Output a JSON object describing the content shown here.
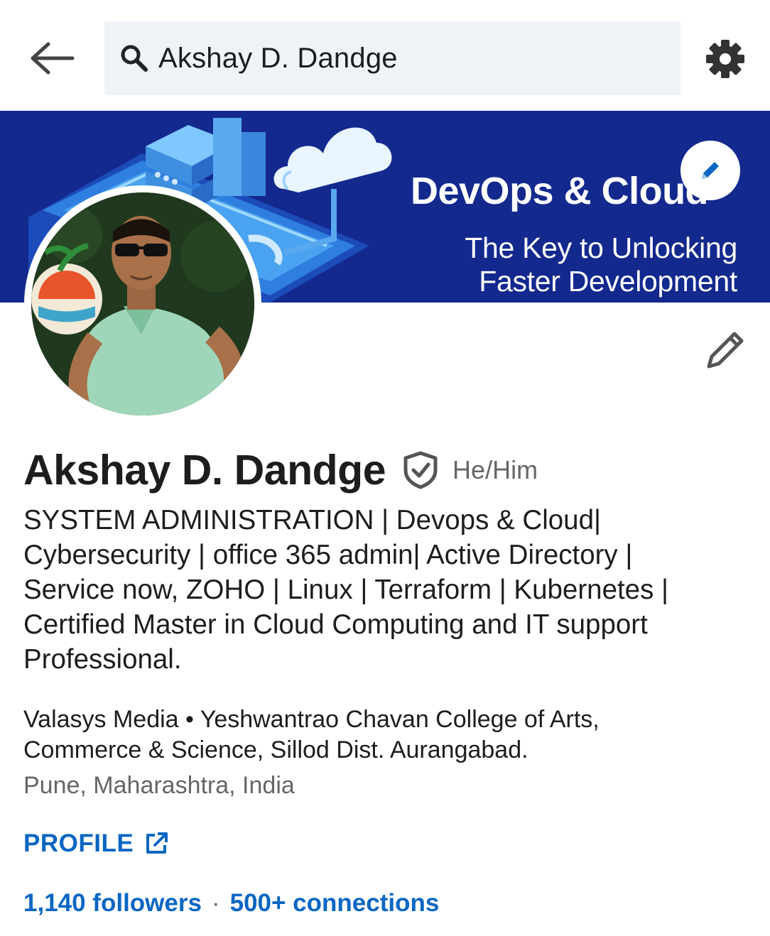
{
  "search": {
    "query": "Akshay D. Dandge"
  },
  "banner": {
    "title": "DevOps & Cloud",
    "subtitle_line1": "The Key to Unlocking",
    "subtitle_line2": "Faster Development",
    "background_color": "#13298e"
  },
  "profile": {
    "name": "Akshay D. Dandge",
    "pronouns": "He/Him",
    "headline": "SYSTEM ADMINISTRATION | Devops & Cloud|\nCybersecurity | office 365 admin| Active Directory |\nService now, ZOHO | Linux | Terraform | Kubernetes |\nCertified  Master in Cloud Computing and IT support\nProfessional.",
    "company_education": "Valasys Media • Yeshwantrao Chavan College of Arts,\nCommerce & Science, Sillod Dist. Aurangabad.",
    "location": "Pune, Maharashtra, India",
    "profile_link_label": "PROFILE",
    "followers": "1,140 followers",
    "separator": "·",
    "connections": "500+ connections"
  },
  "icons": {
    "back": "back-arrow-icon",
    "search": "search-icon",
    "settings": "gear-icon",
    "banner_edit": "pencil-icon",
    "profile_edit": "pencil-icon",
    "verified": "verified-shield-icon",
    "external": "external-link-icon"
  },
  "colors": {
    "link": "#0a66c2",
    "accent_blue": "#13298e",
    "secondary_text": "#666666"
  }
}
